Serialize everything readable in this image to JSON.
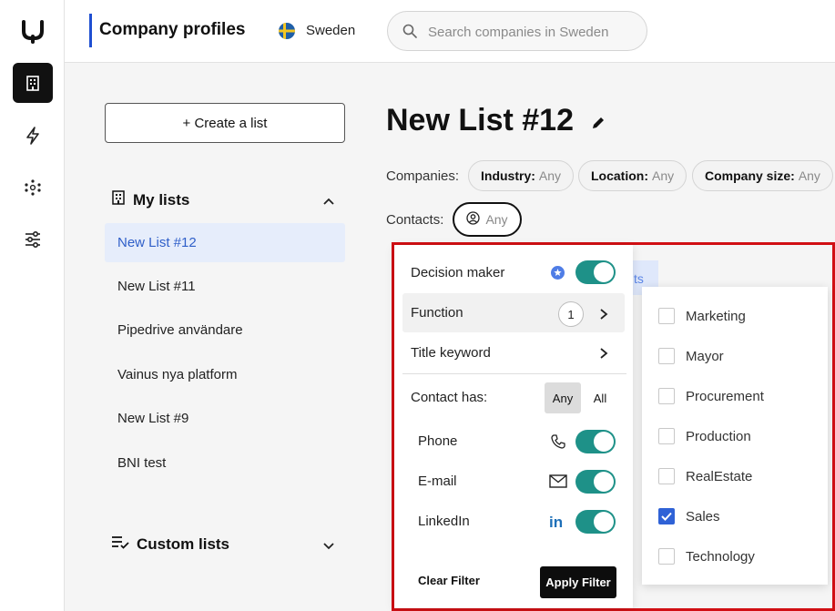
{
  "header": {
    "title": "Company profiles",
    "country": "Sweden",
    "search_placeholder": "Search companies in Sweden"
  },
  "rail": {
    "items": [
      "logo-icon",
      "building-icon",
      "lightning-icon",
      "network-icon",
      "sliders-icon"
    ],
    "active": "building-icon"
  },
  "sidebar": {
    "create_label": "+ Create a list",
    "my_lists_label": "My lists",
    "lists": [
      "New List #12",
      "New List #11",
      "Pipedrive användare",
      "Vainus nya platform",
      "New List #9",
      "BNI test"
    ],
    "active_list": "New List #12",
    "custom_lists_label": "Custom lists"
  },
  "main": {
    "list_title": "New List #12",
    "companies_label": "Companies:",
    "contacts_label": "Contacts:",
    "company_filters": [
      {
        "name": "Industry:",
        "value": "Any"
      },
      {
        "name": "Location:",
        "value": "Any"
      },
      {
        "name": "Company size:",
        "value": "Any"
      }
    ],
    "contacts_value": "Any",
    "background_tab_fragment": "ts"
  },
  "contact_filter": {
    "decision_maker_label": "Decision maker",
    "decision_maker_on": true,
    "function_label": "Function",
    "function_count": "1",
    "title_keyword_label": "Title keyword",
    "contact_has_label": "Contact has:",
    "any_label": "Any",
    "all_label": "All",
    "selected_mode": "Any",
    "channels": [
      {
        "label": "Phone",
        "icon": "phone-icon",
        "on": true
      },
      {
        "label": "E-mail",
        "icon": "mail-icon",
        "on": true
      },
      {
        "label": "LinkedIn",
        "icon": "linkedin-icon",
        "on": true
      }
    ],
    "clear_label": "Clear Filter",
    "apply_label": "Apply Filter"
  },
  "function_options": [
    {
      "label": "Marketing",
      "checked": false
    },
    {
      "label": "Mayor",
      "checked": false
    },
    {
      "label": "Procurement",
      "checked": false
    },
    {
      "label": "Production",
      "checked": false
    },
    {
      "label": "RealEstate",
      "checked": false
    },
    {
      "label": "Sales",
      "checked": true
    },
    {
      "label": "Technology",
      "checked": false
    }
  ],
  "colors": {
    "accent": "#1f4fd1",
    "toggle": "#1e9188",
    "active_list_bg": "#e6edfb",
    "highlight_frame": "#d10f14",
    "checkbox_checked": "#2f62d6"
  }
}
